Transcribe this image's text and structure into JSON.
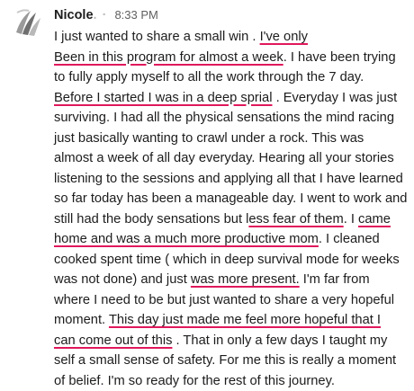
{
  "message": {
    "author": "Nicole",
    "author_suffix": ". ·",
    "timestamp": "8:33 PM",
    "lines": [
      [
        {
          "t": "I just wanted to share a small win . "
        },
        {
          "t": "I've only",
          "hl": true
        }
      ],
      [
        {
          "t": "Been in this program for almost a week",
          "hl": true
        },
        {
          "t": ". I have been trying"
        }
      ],
      [
        {
          "t": "to fully apply myself to all the work through the 7 day."
        }
      ],
      [
        {
          "t": "Before I started I was in a deep sprial",
          "hl": true
        },
        {
          "t": " . Everyday I was just"
        }
      ],
      [
        {
          "t": "surviving. I had all the physical sensations the mind racing"
        }
      ],
      [
        {
          "t": "just basically wanting to crawl under a rock. This was"
        }
      ],
      [
        {
          "t": "almost a week of all day everyday. Hearing all your stories"
        }
      ],
      [
        {
          "t": "listening to the sessions and applying all that I have learned"
        }
      ],
      [
        {
          "t": "so far today has been a manageable day. I went to work and"
        }
      ],
      [
        {
          "t": "still had the body sensations but l"
        },
        {
          "t": "ess fear of them",
          "hl": true
        },
        {
          "t": ". I "
        },
        {
          "t": "came",
          "hl": true
        }
      ],
      [
        {
          "t": "home and was a much more productive mom",
          "hl": true
        },
        {
          "t": ". I cleaned"
        }
      ],
      [
        {
          "t": "cooked spent time ( which in deep  survival mode for weeks"
        }
      ],
      [
        {
          "t": "was not done) and just "
        },
        {
          "t": "was more present.",
          "hl": true
        },
        {
          "t": " I'm far from"
        }
      ],
      [
        {
          "t": "where I need to be but just wanted to share a very hopeful"
        }
      ],
      [
        {
          "t": "moment. "
        },
        {
          "t": "This day just made me feel more hopeful that I",
          "hl": true
        }
      ],
      [
        {
          "t": "can come out of this",
          "hl": true
        },
        {
          "t": " . That in only a few days I taught my"
        }
      ],
      [
        {
          "t": "self a small sense of safety. For me this is really a moment"
        }
      ],
      [
        {
          "t": "of belief. I'm so ready for the rest of this journey."
        }
      ]
    ]
  }
}
